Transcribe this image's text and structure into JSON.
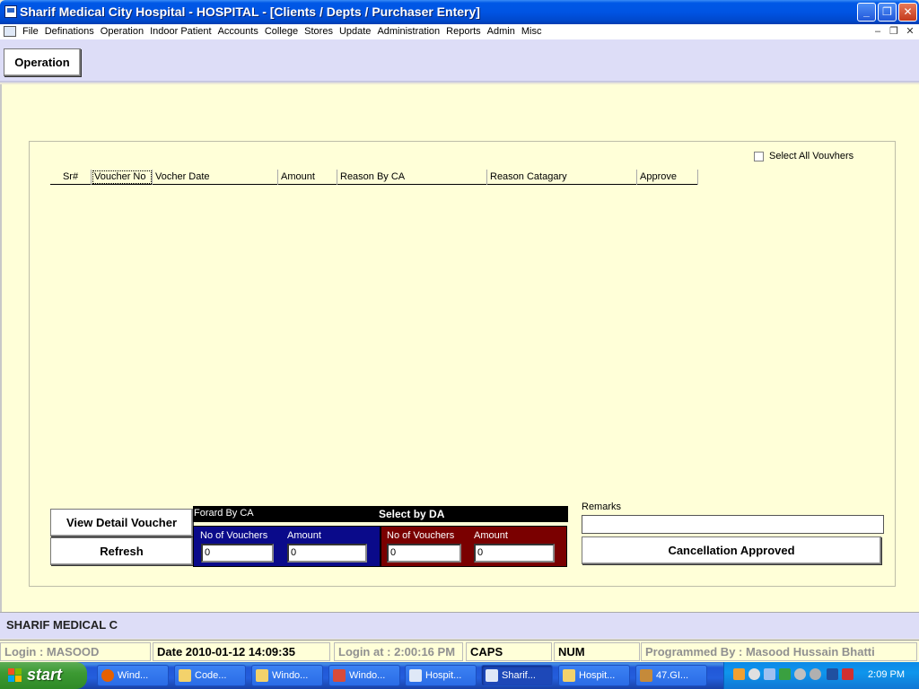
{
  "window": {
    "title": "Sharif Medical City Hospital - HOSPITAL - [Clients / Depts / Purchaser Entery]"
  },
  "menu": [
    "File",
    "Definations",
    "Operation",
    "Indoor Patient",
    "Accounts",
    "College",
    "Stores",
    "Update",
    "Administration",
    "Reports",
    "Admin",
    "Misc"
  ],
  "toolbar": {
    "operation_label": "Operation"
  },
  "select_all_label": "Select All Vouvhers",
  "grid": {
    "columns": [
      "Sr#",
      "Voucher No",
      "Vocher Date",
      "Amount",
      "Reason By CA",
      "Reason Catagary",
      "Approve"
    ]
  },
  "buttons": {
    "view_detail": "View Detail Voucher",
    "refresh": "Refresh",
    "cancellation": "Cancellation Approved"
  },
  "summary": {
    "forward_label": "Forard By CA",
    "select_label": "Select by DA",
    "ca": {
      "vouchers_label": "No of Vouchers",
      "amount_label": "Amount",
      "vouchers": "0",
      "amount": "0"
    },
    "da": {
      "vouchers_label": "No of Vouchers",
      "amount_label": "Amount",
      "vouchers": "0",
      "amount": "0"
    }
  },
  "remarks_label": "Remarks",
  "namebar": "SHARIF MEDICAL C",
  "status": {
    "login": "Login :  MASOOD",
    "date": "Date 2010-01-12 14:09:35",
    "login_at": "Login at : 2:00:16 PM",
    "caps": "CAPS",
    "num": "NUM",
    "programmed": "Programmed By : Masood Hussain Bhatti"
  },
  "taskbar": {
    "start": "start",
    "tasks": [
      "Wind...",
      "Code...",
      "Windo...",
      "Windo...",
      "Hospit...",
      "Sharif...",
      "Hospit...",
      "47.GI..."
    ],
    "clock": "2:09 PM"
  },
  "colors": {
    "ca_box": "#0A0A8A",
    "da_box": "#7A0000",
    "main_bg": "#FFFFD8",
    "bar_bg": "#DDDDF7"
  }
}
